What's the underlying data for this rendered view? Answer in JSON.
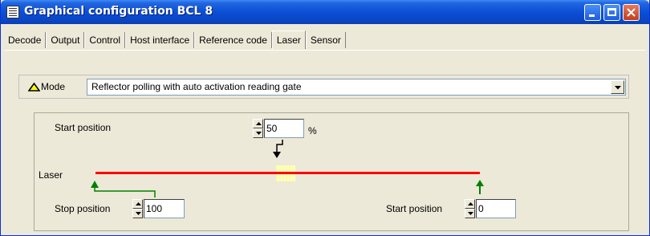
{
  "window": {
    "title": "Graphical configuration BCL 8"
  },
  "tabs": [
    {
      "label": "Decode",
      "active": false
    },
    {
      "label": "Output",
      "active": false
    },
    {
      "label": "Control",
      "active": false
    },
    {
      "label": "Host interface",
      "active": false
    },
    {
      "label": "Reference code",
      "active": false
    },
    {
      "label": "Laser",
      "active": true
    },
    {
      "label": "Sensor",
      "active": false
    }
  ],
  "mode": {
    "label": "Mode",
    "selected": "Reflector polling with auto activation reading gate"
  },
  "laser": {
    "label": "Laser",
    "start_position_label": "Start position",
    "start_position_value": "50",
    "start_position_unit": "%",
    "stop_position_label": "Stop position",
    "stop_position_value": "100",
    "start_position2_label": "Start position",
    "start_position2_value": "0"
  },
  "colors": {
    "laser_line": "#ff0000",
    "marker_arrow": "#008000",
    "title_bar": "#0b4fd6"
  }
}
